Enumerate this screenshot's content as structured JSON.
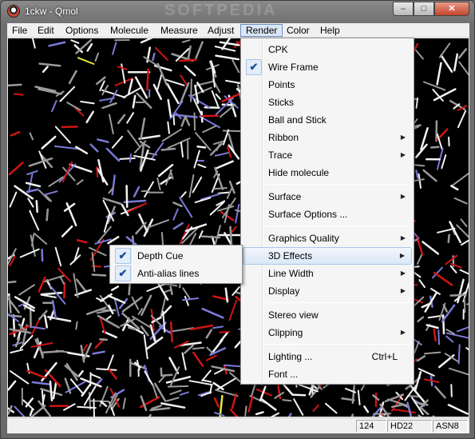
{
  "window": {
    "title": "1ckw - Qmol",
    "watermark": "SOFTPEDIA"
  },
  "caption_buttons": {
    "minimize": "–",
    "maximize": "□",
    "close": "✕"
  },
  "menubar": [
    {
      "label": "File"
    },
    {
      "label": "Edit"
    },
    {
      "label": "Options"
    },
    {
      "label": "Molecule"
    },
    {
      "label": "Measure"
    },
    {
      "label": "Adjust"
    },
    {
      "label": "Render"
    },
    {
      "label": "Color"
    },
    {
      "label": "Help"
    }
  ],
  "render_menu": {
    "items": [
      {
        "label": "CPK"
      },
      {
        "label": "Wire Frame",
        "checked": true
      },
      {
        "label": "Points"
      },
      {
        "label": "Sticks"
      },
      {
        "label": "Ball and Stick"
      },
      {
        "label": "Ribbon",
        "submenu": true
      },
      {
        "label": "Trace",
        "submenu": true
      },
      {
        "label": "Hide molecule"
      },
      {
        "label": "Surface",
        "submenu": true
      },
      {
        "label": "Surface Options ..."
      },
      {
        "label": "Graphics Quality",
        "submenu": true
      },
      {
        "label": "3D Effects",
        "submenu": true,
        "highlighted": true
      },
      {
        "label": "Line Width",
        "submenu": true
      },
      {
        "label": "Display",
        "submenu": true
      },
      {
        "label": "Stereo view"
      },
      {
        "label": "Clipping",
        "submenu": true
      },
      {
        "label": "Lighting ...",
        "shortcut": "Ctrl+L"
      },
      {
        "label": "Font ..."
      }
    ],
    "check_glyph": "✔",
    "arrow_glyph": "▶"
  },
  "effects_submenu": {
    "items": [
      {
        "label": "Depth Cue",
        "checked": true
      },
      {
        "label": "Anti-alias lines",
        "checked": true
      }
    ]
  },
  "statusbar": {
    "cells": [
      "124",
      "HD22",
      "ASN8"
    ]
  },
  "colors": {
    "viewport_bg": "#000000",
    "bond_white": "#f2f2f2",
    "bond_gray": "#9a9a9a",
    "bond_red": "#d01515",
    "bond_blue": "#7a7ad8",
    "bond_yellow": "#e8e840",
    "highlight": "#dae8f8"
  }
}
